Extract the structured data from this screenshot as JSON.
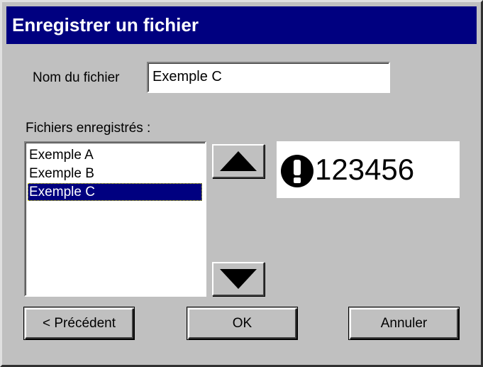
{
  "window": {
    "title": "Enregistrer un fichier"
  },
  "filename": {
    "label": "Nom du fichier",
    "value": "Exemple C"
  },
  "saved_files": {
    "label": "Fichiers enregistrés :",
    "items": [
      {
        "label": "Exemple A",
        "selected": false
      },
      {
        "label": "Exemple B",
        "selected": false
      },
      {
        "label": "Exemple C",
        "selected": true
      }
    ]
  },
  "preview": {
    "icon": "exclamation-circle-icon",
    "text": "123456"
  },
  "scroll": {
    "up_icon": "arrow-up-icon",
    "down_icon": "arrow-down-icon"
  },
  "buttons": {
    "back": "< Précédent",
    "ok": "OK",
    "cancel": "Annuler"
  },
  "colors": {
    "titlebar": "#000080",
    "dialog": "#c0c0c0",
    "selection": "#000080"
  }
}
